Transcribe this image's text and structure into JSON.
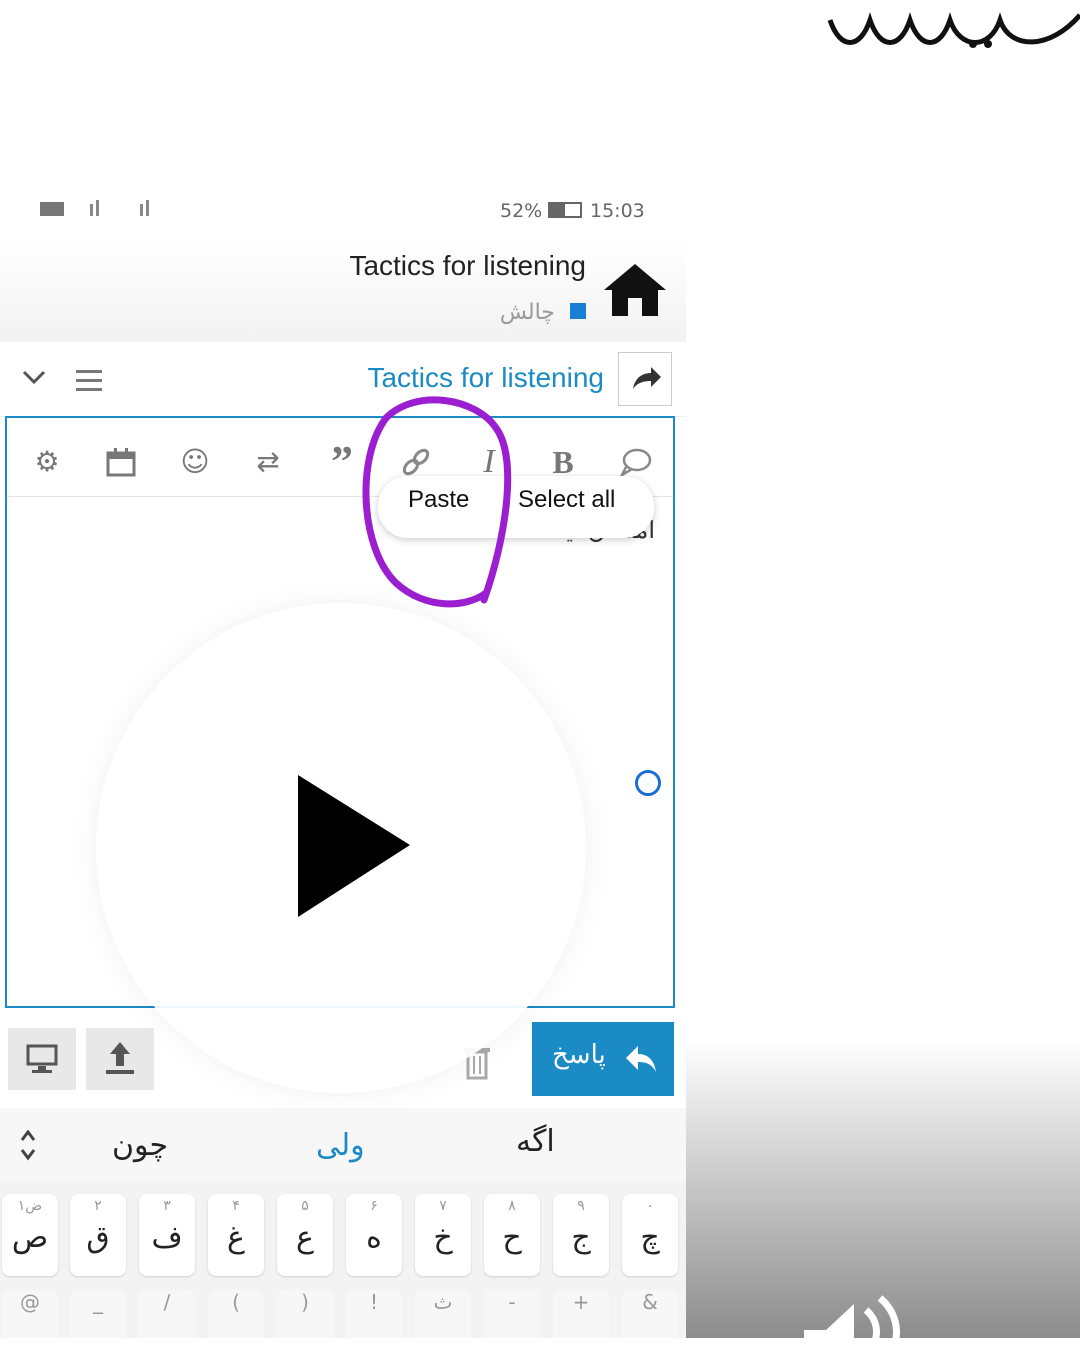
{
  "status": {
    "battery": "52%",
    "time": "15:03"
  },
  "header": {
    "title": "Tactics for listening",
    "category": "چالش",
    "home_icon": "home-icon"
  },
  "thread": {
    "title": "Tactics for listening"
  },
  "context_menu": {
    "paste": "Paste",
    "select_all": "Select all"
  },
  "editor": {
    "text": "امتحان تیست"
  },
  "reply_button": {
    "label": "پاسخ"
  },
  "suggestions": [
    "اگه",
    "ولی",
    "چون"
  ],
  "keyboard": {
    "row1": [
      {
        "hint": "۰",
        "main": "چ"
      },
      {
        "hint": "۹",
        "main": "ج"
      },
      {
        "hint": "۸",
        "main": "ح"
      },
      {
        "hint": "۷",
        "main": "خ"
      },
      {
        "hint": "۶",
        "main": "ه"
      },
      {
        "hint": "۵",
        "main": "ع"
      },
      {
        "hint": "۴",
        "main": "غ"
      },
      {
        "hint": "۳",
        "main": "ف"
      },
      {
        "hint": "۲",
        "main": "ق"
      },
      {
        "hint": "۱ض",
        "main": "ص"
      }
    ],
    "row2": [
      "&",
      "+",
      "-",
      "ث",
      "!",
      ")",
      "(",
      "/",
      "_",
      "@"
    ]
  },
  "colors": {
    "accent": "#1a8bc4",
    "circle": "#9b1fd1",
    "reply": "#1a8bc4"
  }
}
